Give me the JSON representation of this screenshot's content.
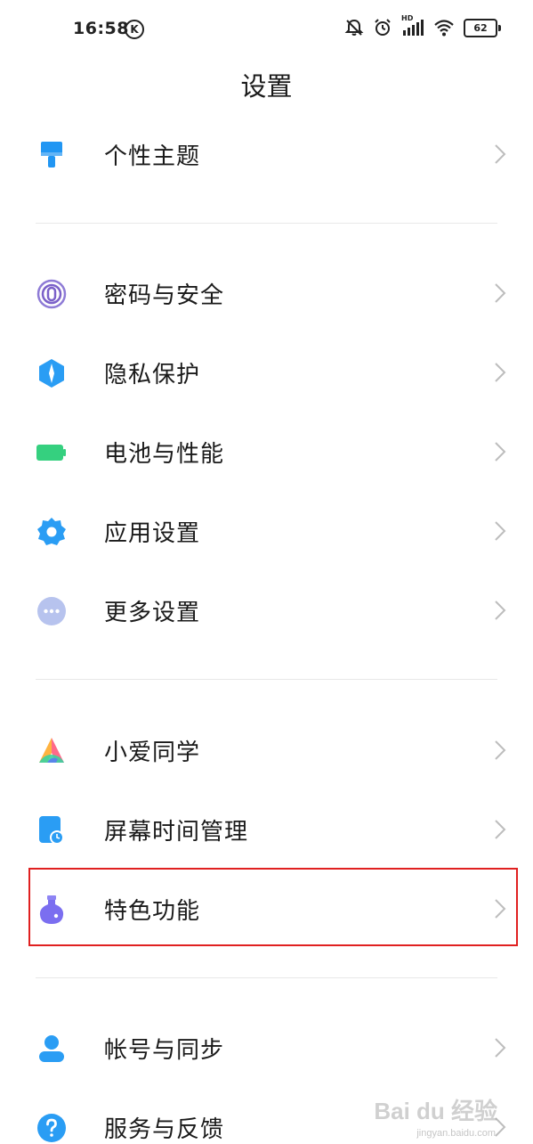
{
  "status_bar": {
    "time": "16:58",
    "k_badge": "K",
    "battery_level": "62",
    "hd_label": "HD",
    "icons": [
      "bell-off-icon",
      "alarm-icon",
      "signal-icon",
      "wifi-icon",
      "battery-icon"
    ]
  },
  "header": {
    "title": "设置"
  },
  "items": [
    {
      "label": "个性主题",
      "icon": "theme-brush-icon",
      "color": "#2196f3"
    },
    {
      "label": "密码与安全",
      "icon": "fingerprint-icon",
      "color": "#7b61c9"
    },
    {
      "label": "隐私保护",
      "icon": "privacy-shield-icon",
      "color": "#2a9df4"
    },
    {
      "label": "电池与性能",
      "icon": "battery-performance-icon",
      "color": "#35d07f"
    },
    {
      "label": "应用设置",
      "icon": "app-settings-gear-icon",
      "color": "#2a9df4"
    },
    {
      "label": "更多设置",
      "icon": "more-settings-icon",
      "color": "#a9b8ea"
    },
    {
      "label": "小爱同学",
      "icon": "xiaoai-icon",
      "color": "#7a5ae0"
    },
    {
      "label": "屏幕时间管理",
      "icon": "screen-time-icon",
      "color": "#2a9df4"
    },
    {
      "label": "特色功能",
      "icon": "special-features-flask-icon",
      "color": "#7b6ef0"
    },
    {
      "label": "帐号与同步",
      "icon": "account-sync-icon",
      "color": "#2a9df4"
    },
    {
      "label": "服务与反馈",
      "icon": "service-feedback-icon",
      "color": "#2a9df4"
    }
  ],
  "highlight": {
    "color": "#e02020",
    "target": "特色功能"
  },
  "watermark": {
    "brand": "Bai du 经验",
    "url": "jingyan.baidu.com"
  }
}
